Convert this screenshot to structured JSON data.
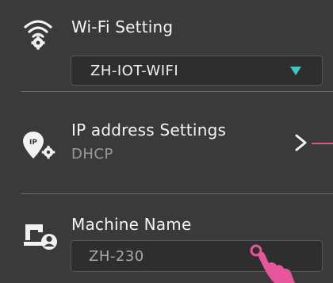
{
  "wifi": {
    "title": "Wi-Fi Setting",
    "selected_network": "ZH-IOT-WIFI",
    "icon": "wifi-gear-icon"
  },
  "ip": {
    "title": "IP address Settings",
    "mode": "DHCP",
    "icon": "location-gear-icon"
  },
  "machine": {
    "title": "Machine Name",
    "value": "ZH-230",
    "icon": "machine-user-icon"
  },
  "colors": {
    "background": "#3a3a3a",
    "accent": "#43c6c2",
    "highlight": "#d9568f"
  }
}
